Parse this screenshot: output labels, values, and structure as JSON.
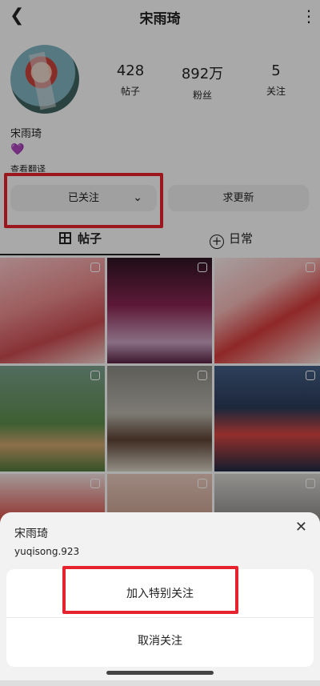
{
  "header": {
    "back_icon": "←",
    "title": "宋雨琦",
    "more_icon": "⋮"
  },
  "profile": {
    "avatar": "avatar",
    "stats": [
      {
        "value": "428",
        "label": "帖子"
      },
      {
        "value": "892万",
        "label": "粉丝"
      },
      {
        "value": "5",
        "label": "关注"
      }
    ],
    "name": "宋雨琦",
    "heart_icon": "💜",
    "translate_label": "查看翻译"
  },
  "actions": {
    "followed_label": "已关注",
    "request_update_label": "求更新"
  },
  "tabs": {
    "posts_label": "帖子",
    "daily_label": "日常"
  },
  "highlight_color": "#e6232c",
  "sheet": {
    "name": "宋雨琦",
    "handle": "yuqisong.923",
    "close_icon": "✕",
    "items": [
      {
        "label": "加入特别关注"
      },
      {
        "label": "取消关注"
      }
    ]
  }
}
